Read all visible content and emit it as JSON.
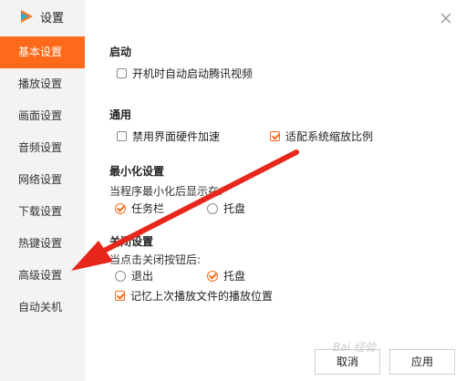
{
  "app": {
    "title": "设置",
    "logo_icon": "tencent-video-logo-icon"
  },
  "sidebar": {
    "items": [
      {
        "label": "基本设置",
        "active": true
      },
      {
        "label": "播放设置",
        "active": false
      },
      {
        "label": "画面设置",
        "active": false
      },
      {
        "label": "音频设置",
        "active": false
      },
      {
        "label": "网络设置",
        "active": false
      },
      {
        "label": "下载设置",
        "active": false
      },
      {
        "label": "热键设置",
        "active": false
      },
      {
        "label": "高级设置",
        "active": false
      },
      {
        "label": "自动关机",
        "active": false
      }
    ]
  },
  "sections": {
    "startup": {
      "title": "启动",
      "auto_start_label": "开机时自动启动腾讯视频",
      "auto_start_checked": false
    },
    "general": {
      "title": "通用",
      "hw_accel_label": "禁用界面硬件加速",
      "hw_accel_checked": false,
      "scale_label": "适配系统缩放比例",
      "scale_checked": true
    },
    "minimize": {
      "title": "最小化设置",
      "hint": "当程序最小化后显示在:",
      "taskbar_label": "任务栏",
      "taskbar_selected": true,
      "tray_label": "托盘",
      "tray_selected": false
    },
    "close": {
      "title": "关闭设置",
      "hint": "当点击关闭按钮后:",
      "exit_label": "退出",
      "exit_selected": false,
      "tray_label": "托盘",
      "tray_selected": true,
      "remember_label": "记忆上次播放文件的播放位置",
      "remember_checked": true
    }
  },
  "footer": {
    "cancel_label": "取消",
    "apply_label": "应用"
  },
  "watermark": "Bai 经验",
  "colors": {
    "accent": "#ff6a1a",
    "arrow": "#e8271c",
    "sidebar_bg": "#f3f3f3"
  }
}
